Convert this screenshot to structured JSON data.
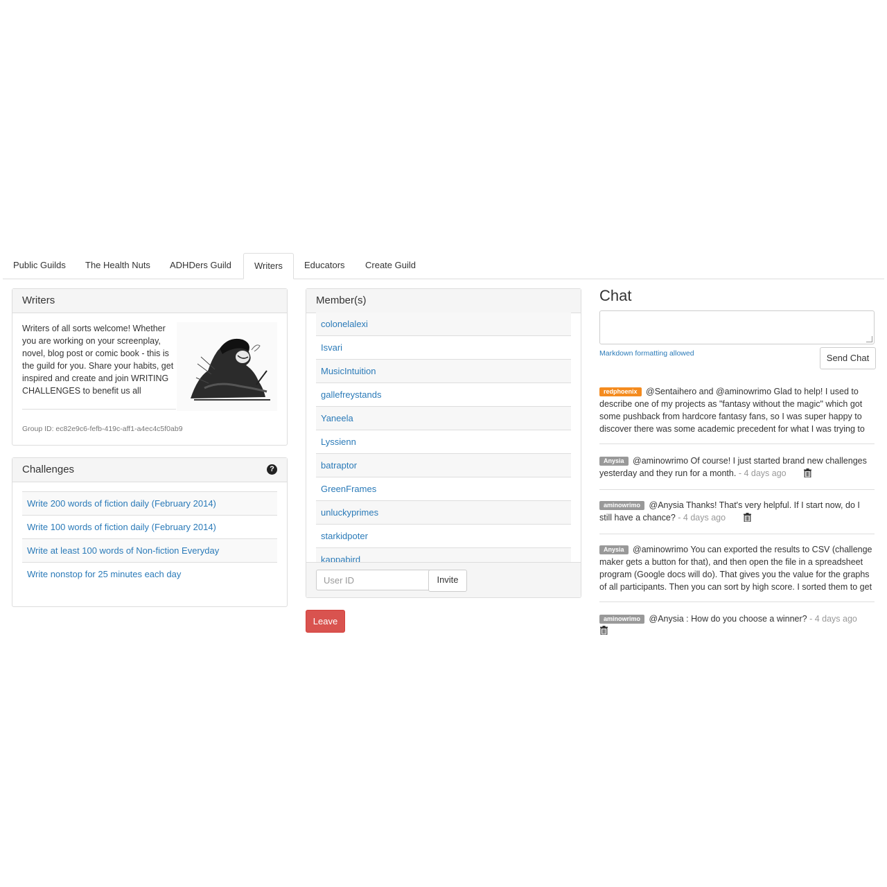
{
  "tabs": [
    {
      "label": "Public Guilds",
      "active": false
    },
    {
      "label": "The Health Nuts",
      "active": false
    },
    {
      "label": "ADHDers Guild",
      "active": false
    },
    {
      "label": "Writers",
      "active": true
    },
    {
      "label": "Educators",
      "active": false
    },
    {
      "label": "Create Guild",
      "active": false
    }
  ],
  "guild": {
    "title": "Writers",
    "description": "Writers of all sorts welcome! Whether you are working on your screenplay, novel, blog post or comic book - this is the guild for you. Share your habits, get inspired and create and join WRITING CHALLENGES to benefit us all",
    "group_id": "Group ID: ec82e9c6-fefb-419c-aff1-a4ec4c5f0ab9"
  },
  "challenges": {
    "title": "Challenges",
    "help_icon": "question-circle-icon",
    "items": [
      "Write 200 words of fiction daily (February 2014)",
      "Write 100 words of fiction daily (February 2014)",
      "Write at least 100 words of Non-fiction Everyday",
      "Write nonstop for 25 minutes each day"
    ]
  },
  "members": {
    "title": "Member(s)",
    "items": [
      "colonelalexi",
      "Isvari",
      "MusicIntuition",
      "gallefreystands",
      "Yaneela",
      "Lyssienn",
      "batraptor",
      "GreenFrames",
      "unluckyprimes",
      "starkidpoter",
      "kappabird"
    ],
    "invite_placeholder": "User ID",
    "invite_label": "Invite",
    "leave_label": "Leave"
  },
  "chat": {
    "title": "Chat",
    "markdown_note": "Markdown formatting allowed",
    "send_label": "Send Chat",
    "messages": [
      {
        "user": "redphoenix",
        "badge_color": "#f48b1f",
        "text": "@Sentaihero and @aminowrimo Glad to help! I used to describe one of my projects as \"fantasy without the magic\" which got some pushback from hardcore fantasy fans, so I was super happy to discover there was some academic precedent for what I was trying to",
        "time": ""
      },
      {
        "user": "Anysia",
        "badge_color": "#999999",
        "text": "@aminowrimo Of course! I just started brand new challenges yesterday and they run for a month.",
        "time": "- 4 days ago"
      },
      {
        "user": "aminowrimo",
        "badge_color": "#999999",
        "text": "@Anysia Thanks! That's very helpful. If I start now, do I still have a chance?",
        "time": "- 4 days ago"
      },
      {
        "user": "Anysia",
        "badge_color": "#999999",
        "text": "@aminowrimo You can exported the results to CSV (challenge maker gets a button for that), and then open the file in a spreadsheet program (Google docs will do). That gives you the value for the graphs of all participants. Then you can sort by high score. I sorted them to get",
        "time": ""
      },
      {
        "user": "aminowrimo",
        "badge_color": "#999999",
        "text": "@Anysia : How do you choose a winner?",
        "time": "- 4 days ago"
      }
    ]
  }
}
